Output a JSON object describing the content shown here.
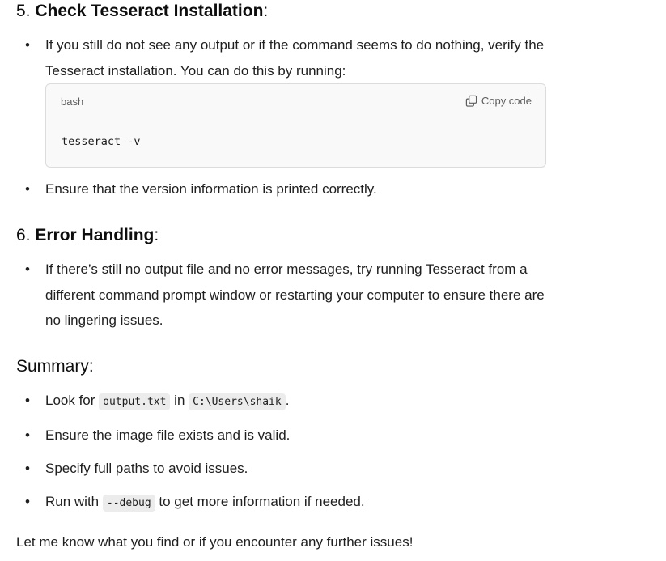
{
  "section5": {
    "number": "5. ",
    "title": "Check Tesseract Installation",
    "suffix": ":",
    "bullet1": "If you still do not see any output or if the command seems to do nothing, verify the Tesseract installation. You can do this by running:",
    "code_block": {
      "language": "bash",
      "copy_label": "Copy code",
      "copy_icon": "copy-icon",
      "code": "tesseract -v"
    },
    "bullet2": "Ensure that the version information is printed correctly."
  },
  "section6": {
    "number": "6. ",
    "title": "Error Handling",
    "suffix": ":",
    "bullet1": "If there’s still no output file and no error messages, try running Tesseract from a different command prompt window or restarting your computer to ensure there are no lingering issues."
  },
  "summary": {
    "heading": "Summary:",
    "item1": {
      "prefix": "Look for ",
      "code1": "output.txt",
      "middle": " in ",
      "code2": "C:\\Users\\shaik",
      "suffix": "."
    },
    "item2": "Ensure the image file exists and is valid.",
    "item3": "Specify full paths to avoid issues.",
    "item4": {
      "prefix": "Run with ",
      "code": "--debug",
      "suffix": " to get more information if needed."
    }
  },
  "closing": "Let me know what you find or if you encounter any further issues!",
  "colors": {
    "text": "#0d0d0d",
    "code_bg": "#f9f9f9",
    "inline_code_bg": "#ececec",
    "muted": "#5d5d5d"
  }
}
